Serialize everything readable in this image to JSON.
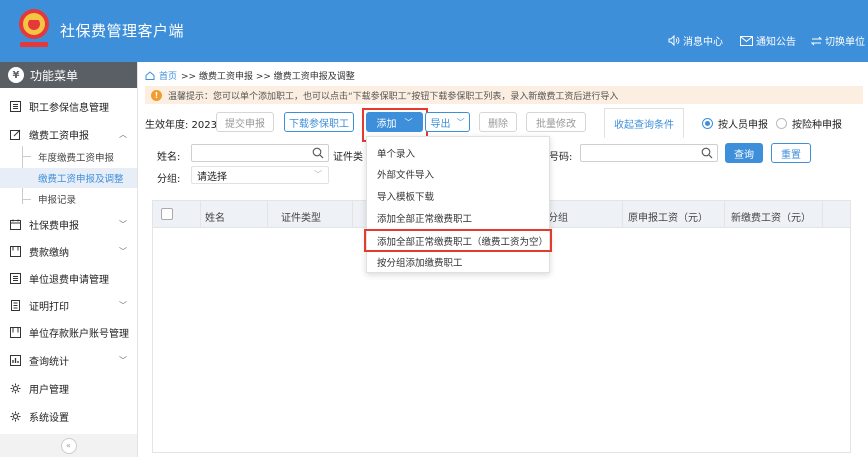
{
  "header": {
    "app_title": "社保费管理客户端",
    "links": [
      "消息中心",
      "通知公告",
      "切换单位"
    ]
  },
  "sidebar": {
    "title": "功能菜单",
    "items": [
      {
        "label": "职工参保信息管理",
        "has_chevron": false
      },
      {
        "label": "缴费工资申报",
        "has_chevron": true,
        "expanded": true
      },
      {
        "label": "社保费申报",
        "has_chevron": true
      },
      {
        "label": "费款缴纳",
        "has_chevron": true
      },
      {
        "label": "单位退费申请管理",
        "has_chevron": false
      },
      {
        "label": "证明打印",
        "has_chevron": true
      },
      {
        "label": "单位存款账户账号管理",
        "has_chevron": false
      },
      {
        "label": "查询统计",
        "has_chevron": true
      },
      {
        "label": "用户管理",
        "has_chevron": false
      },
      {
        "label": "系统设置",
        "has_chevron": false
      }
    ],
    "sub_items": [
      "年度缴费工资申报",
      "缴费工资申报及调整",
      "申报记录"
    ],
    "active_sub": "缴费工资申报及调整",
    "collapse_icon": "«"
  },
  "breadcrumb": {
    "home": "首页",
    "path": ">> 缴费工资申报 >> 缴费工资申报及调整"
  },
  "tip": {
    "text": "温馨提示：您可以单个添加职工，也可以点击“下载参保职工”按钮下载参保职工列表，录入新缴费工资后进行导入"
  },
  "toolbar": {
    "year_label": "生效年度: 2023",
    "submit": "提交申报",
    "download": "下载参保职工",
    "add": "添加",
    "export": "导出",
    "delete": "删除",
    "batch_edit": "批量修改",
    "collapse_filters": "收起查询条件",
    "radio_person": "按人员申报",
    "radio_insurance": "按险种申报",
    "radio_selected": "按人员申报"
  },
  "filters": {
    "name_label": "姓名:",
    "id_type_label": "证件类",
    "id_no_label": "号码:",
    "group_label": "分组:",
    "group_value": "请选择",
    "query": "查询",
    "reset": "重置"
  },
  "table": {
    "headers": [
      "姓名",
      "证件类型",
      "分组",
      "原申报工资（元）",
      "新缴费工资（元）"
    ]
  },
  "dropdown": {
    "items": [
      "单个录入",
      "外部文件导入",
      "导入模板下载",
      "添加全部正常缴费职工",
      "添加全部正常缴费职工（缴费工资为空）",
      "按分组添加缴费职工"
    ],
    "highlighted": "添加全部正常缴费职工（缴费工资为空）"
  },
  "colors": {
    "brand": "#3E8FDA",
    "menu_head": "#5A5F66",
    "highlight": "#E53B2F",
    "tip_bg": "#FCEFE1"
  }
}
